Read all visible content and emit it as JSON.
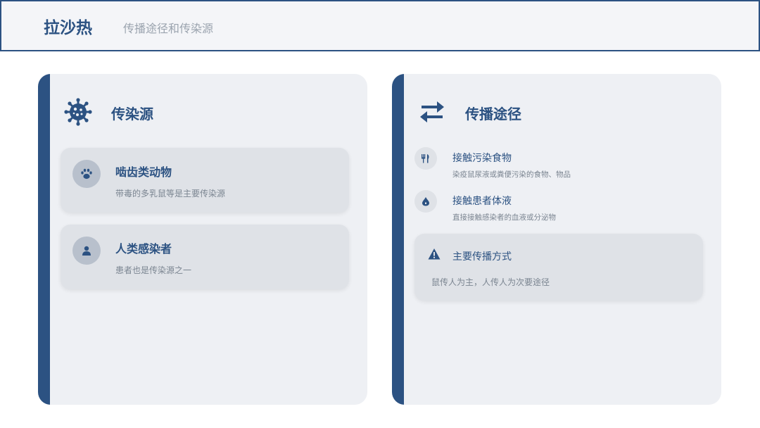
{
  "header": {
    "title": "拉沙热",
    "subtitle": "传播途径和传染源"
  },
  "colors": {
    "primary": "#2c5282",
    "panel_bg": "#eef0f4",
    "card_bg": "#dfe2e7",
    "muted_text": "#7b8591"
  },
  "source_panel": {
    "title": "传染源",
    "icon": "virus-icon",
    "cards": [
      {
        "icon": "paw-icon",
        "title": "啮齿类动物",
        "desc": "带毒的多乳鼠等是主要传染源"
      },
      {
        "icon": "person-icon",
        "title": "人类感染者",
        "desc": "患者也是传染源之一"
      }
    ]
  },
  "route_panel": {
    "title": "传播途径",
    "icon": "exchange-arrows-icon",
    "routes": [
      {
        "icon": "utensils-icon",
        "title": "接触污染食物",
        "desc": "染疫鼠尿液或粪便污染的食物、物品"
      },
      {
        "icon": "droplet-icon",
        "title": "接触患者体液",
        "desc": "直接接触感染者的血液或分泌物"
      }
    ],
    "note": {
      "icon": "warning-icon",
      "title": "主要传播方式",
      "desc": "鼠传人为主，人传人为次要途径"
    }
  }
}
